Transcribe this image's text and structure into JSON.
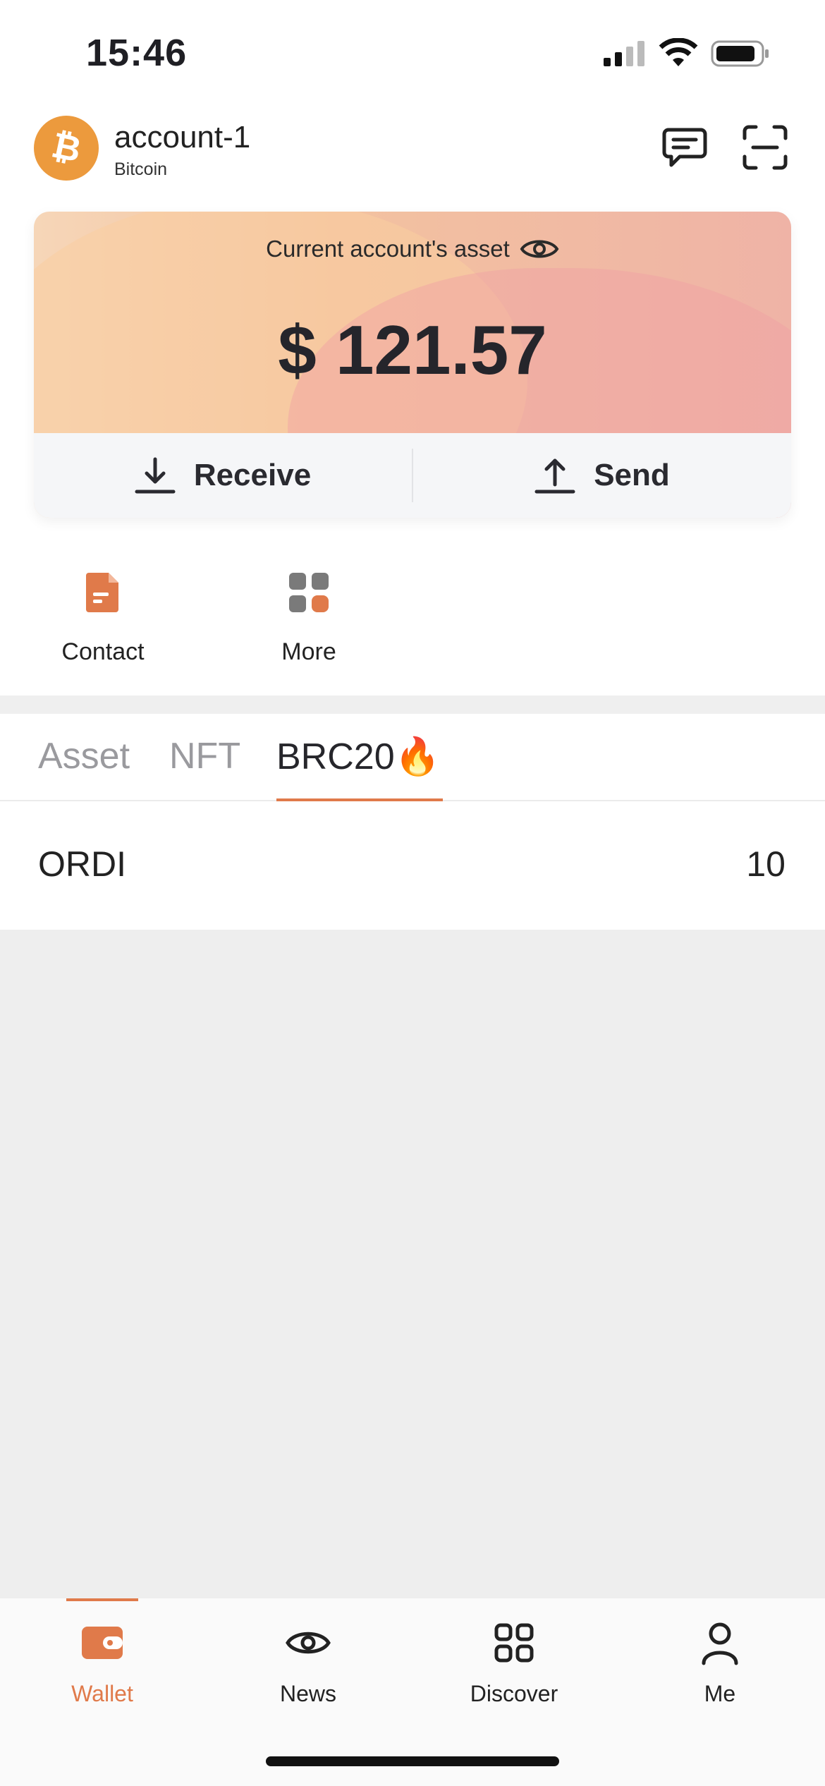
{
  "status_bar": {
    "time": "15:46"
  },
  "header": {
    "account_name": "account-1",
    "chain": "Bitcoin",
    "icons": [
      "bitcoin-icon",
      "message-icon",
      "scan-icon"
    ]
  },
  "asset_card": {
    "label": "Current account's asset",
    "value": "$ 121.57",
    "actions": {
      "receive": "Receive",
      "send": "Send"
    }
  },
  "shortcuts": [
    {
      "label": "Contact",
      "icon": "contact-document-icon"
    },
    {
      "label": "More",
      "icon": "more-grid-icon"
    }
  ],
  "tabs": {
    "asset": "Asset",
    "nft": "NFT",
    "brc20": "BRC20🔥",
    "active": "BRC20"
  },
  "tokens": [
    {
      "name": "ORDI",
      "amount": "10"
    }
  ],
  "tab_bar": {
    "items": [
      "Wallet",
      "News",
      "Discover",
      "Me"
    ],
    "active": "Wallet"
  },
  "colors": {
    "accent": "#e07a4a",
    "bitcoin": "#ec9a3d"
  }
}
